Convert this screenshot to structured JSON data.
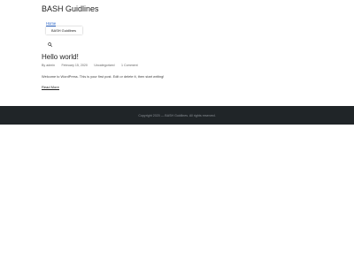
{
  "header": {
    "site_title": "BASH Guidlines",
    "nav": {
      "home_label": "Home",
      "submenu_item_label": "BASH Guidlines"
    },
    "search_icon": "search-icon"
  },
  "post": {
    "title": "Hello world!",
    "meta": {
      "author": "By admin",
      "date": "February 15, 2020",
      "category": "Uncategorized",
      "comments": "1 Comment"
    },
    "excerpt": "Welcome to WordPress. This is your first post. Edit or delete it, then start writing!",
    "read_more_label": "Read More"
  },
  "footer": {
    "copyright": "Copyright 2020 — BASH Guidlines. All rights reserved."
  },
  "colors": {
    "link_accent": "#2563c9",
    "footer_bg": "#202528",
    "footer_text": "#8b9096"
  }
}
